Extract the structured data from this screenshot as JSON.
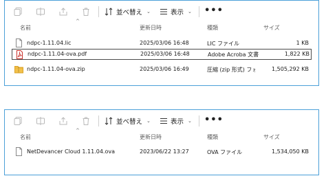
{
  "toolbar": {
    "sort_label": "並べ替え",
    "view_label": "表示",
    "more_label": "•••"
  },
  "columns": {
    "name": "名前",
    "modified": "更新日時",
    "type": "種類",
    "size": "サイズ"
  },
  "pane1": {
    "files": [
      {
        "name": "ndpc-1.11.04.lic",
        "modified": "2025/03/06 16:48",
        "type": "LIC ファイル",
        "size": "1 KB",
        "icon": "file-icon"
      },
      {
        "name": "ndpc-1.11.04-ova.pdf",
        "modified": "2025/03/06 16:48",
        "type": "Adobe Acroba 文書",
        "size": "1,822 KB",
        "icon": "pdf-icon"
      },
      {
        "name": "ndpc-1.11.04-ova.zip",
        "modified": "2025/03/06 16:49",
        "type": "圧縮 (zip 形式) フォ...",
        "size": "1,505,292 KB",
        "icon": "zip-folder-icon"
      }
    ]
  },
  "pane2": {
    "files": [
      {
        "name": "NetDevancer Cloud 1.11.04.ova",
        "modified": "2023/06/22 13:27",
        "type": "OVA ファイル",
        "size": "1,534,050 KB",
        "icon": "file-icon"
      }
    ]
  }
}
